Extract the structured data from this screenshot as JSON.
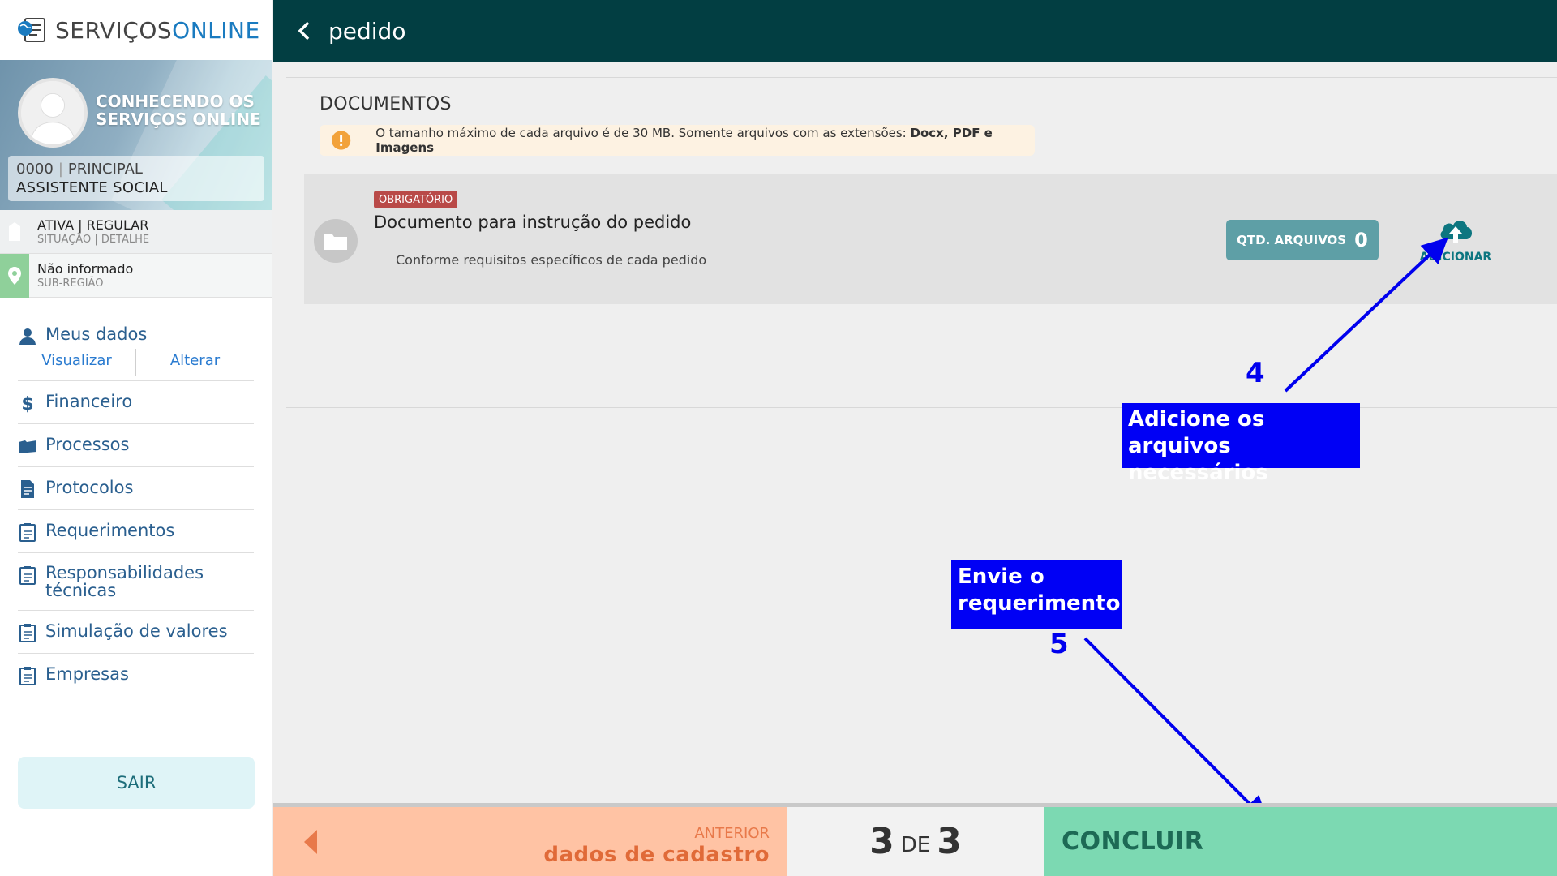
{
  "app": {
    "logo_part1": "SERVIÇOS",
    "logo_part2": "ONLINE"
  },
  "profile": {
    "name": "CONHECENDO OS SERVIÇOS ONLINE",
    "number": "0000",
    "type": "PRINCIPAL",
    "role": "ASSISTENTE SOCIAL"
  },
  "status": {
    "value": "ATIVA | REGULAR",
    "label": "SITUAÇÃO | DETALHE"
  },
  "region": {
    "value": "Não informado",
    "label": "SUB-REGIÃO"
  },
  "menu": {
    "meus_dados": "Meus dados",
    "visualizar": "Visualizar",
    "alterar": "Alterar",
    "items": [
      {
        "label": "Financeiro",
        "icon": "dollar-icon"
      },
      {
        "label": "Processos",
        "icon": "folder-icon"
      },
      {
        "label": "Protocolos",
        "icon": "document-icon"
      },
      {
        "label": "Requerimentos",
        "icon": "clipboard-icon"
      },
      {
        "label": "Responsabilidades técnicas",
        "icon": "clipboard-icon"
      },
      {
        "label": "Simulação de valores",
        "icon": "clipboard-icon"
      },
      {
        "label": "Empresas",
        "icon": "clipboard-icon"
      }
    ],
    "sair": "SAIR"
  },
  "header": {
    "title": "pedido"
  },
  "documents": {
    "section_title": "DOCUMENTOS",
    "warning_text": "O tamanho máximo de cada arquivo é de 30 MB. Somente arquivos com as extensões: ",
    "warning_bold": "Docx, PDF e Imagens",
    "item": {
      "badge": "OBRIGATÓRIO",
      "title": "Documento para instrução do pedido",
      "description": "Conforme requisitos específicos de cada pedido",
      "qtd_label": "QTD. ARQUIVOS",
      "qtd_value": "0",
      "add_label": "ADICIONAR"
    }
  },
  "annotations": {
    "step4_number": "4",
    "step4_text": "Adicione os arquivos necessários",
    "step5_number": "5",
    "step5_text": "Envie o requerimento",
    "color": "#0000f5"
  },
  "footer": {
    "prev_small": "ANTERIOR",
    "prev_big": "dados de cadastro",
    "page_current": "3",
    "page_sep": "DE",
    "page_total": "3",
    "next": "CONCLUIR"
  },
  "colors": {
    "header": "#023e42",
    "prev": "#ffc3a4",
    "next": "#7cd9b2",
    "badge": "#b94a48",
    "qtd": "#5e9fa6"
  }
}
